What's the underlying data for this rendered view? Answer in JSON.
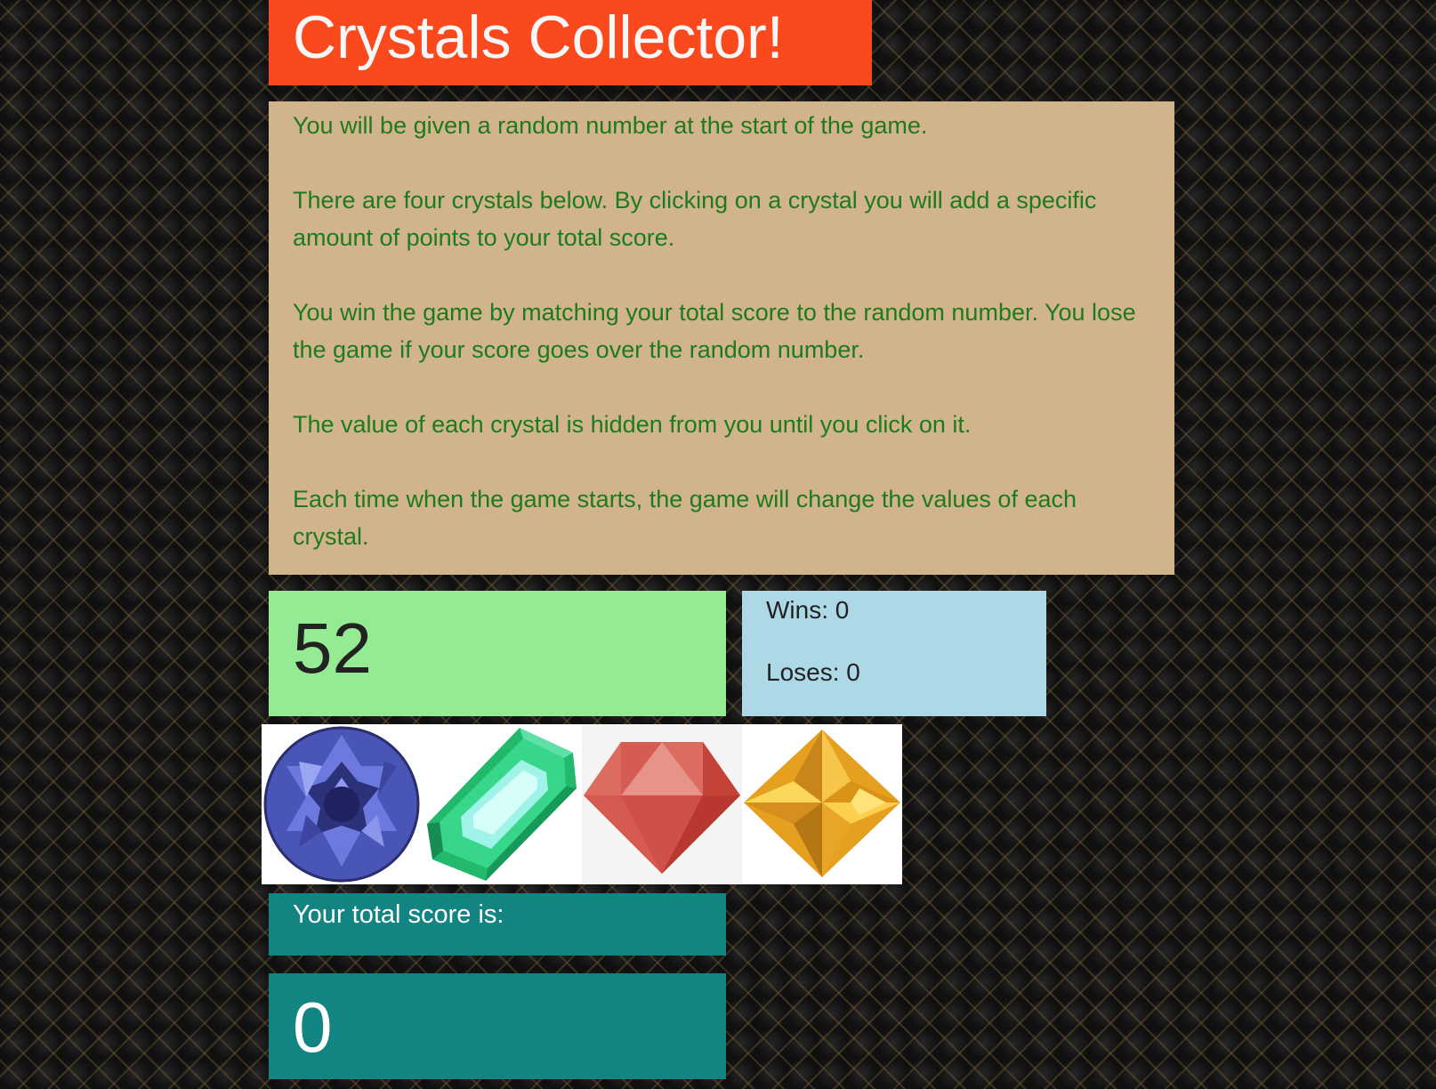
{
  "title": "Crystals Collector!",
  "instructions": [
    "You will be given a random number at the start of the game.",
    "There are four crystals below. By clicking on a crystal you will add a specific amount of points to your total score.",
    "You win the game by matching your total score to the random number. You lose the game if your score goes over the random number.",
    "The value of each crystal is hidden from you until you click on it.",
    "Each time when the game starts, the game will change the values of each crystal."
  ],
  "target_number": "52",
  "stats": {
    "wins": "Wins: 0",
    "loses": "Loses: 0"
  },
  "crystals": [
    {
      "name": "blue-crystal-icon",
      "color": "#4f5fc8"
    },
    {
      "name": "green-crystal-icon",
      "color": "#2fd38c"
    },
    {
      "name": "red-crystal-icon",
      "color": "#d8564c"
    },
    {
      "name": "yellow-crystal-icon",
      "color": "#f0b02a"
    }
  ],
  "score": {
    "label": "Your total score is:",
    "value": "0"
  },
  "colors": {
    "title_bg": "#fa4a1d",
    "instructions_bg": "#d1b48c",
    "instructions_text": "#1e7a1e",
    "target_bg": "#94eb94",
    "stats_bg": "#add8e6",
    "score_bg": "#128481"
  }
}
